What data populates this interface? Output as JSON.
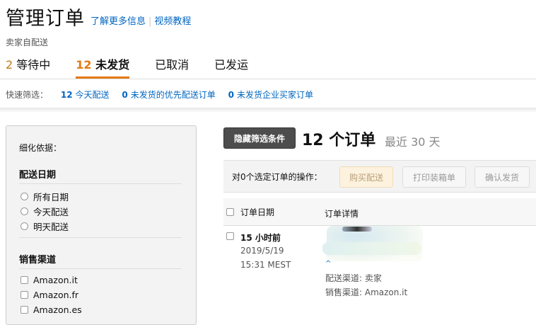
{
  "header": {
    "title": "管理订单",
    "links": [
      "了解更多信息",
      "视频教程"
    ],
    "subtitle": "卖家自配送"
  },
  "tabs": [
    {
      "count": "2",
      "label": "等待中",
      "active": false
    },
    {
      "count": "12",
      "label": "未发货",
      "active": true
    },
    {
      "count": "",
      "label": "已取消",
      "active": false
    },
    {
      "count": "",
      "label": "已发运",
      "active": false
    }
  ],
  "quick_filter": {
    "label": "快速筛选：",
    "items": [
      {
        "count": "12",
        "text": "今天配送"
      },
      {
        "count": "0",
        "text": "未发货的优先配送订单"
      },
      {
        "count": "0",
        "text": "未发货企业买家订单"
      }
    ]
  },
  "sidebar": {
    "refine_label": "细化依据：",
    "delivery_date": {
      "title": "配送日期",
      "options": [
        "所有日期",
        "今天配送",
        "明天配送"
      ]
    },
    "sales_channel": {
      "title": "销售渠道",
      "options": [
        "Amazon.it",
        "Amazon.fr",
        "Amazon.es"
      ]
    }
  },
  "toolbar": {
    "hide_filters": "隐藏筛选条件",
    "order_count": "12 个订单",
    "recent": "最近 30 天"
  },
  "actions": {
    "label": "对0个选定订单的操作：",
    "buy_shipping": "购买配送",
    "print_packing": "打印装箱单",
    "confirm_shipment": "确认发货"
  },
  "table": {
    "col_date": "订单日期",
    "col_detail": "订单详情"
  },
  "order": {
    "time_ago": "15 小时前",
    "date": "2019/5/19",
    "clock": "15:31 MEST",
    "ship_channel": "配送渠道: 卖家",
    "sales_channel": "销售渠道: Amazon.it"
  },
  "colors": {
    "link": "#0066c0",
    "active_tab_underline": "#e47911",
    "hide_button_bg": "#4d4d4d"
  }
}
